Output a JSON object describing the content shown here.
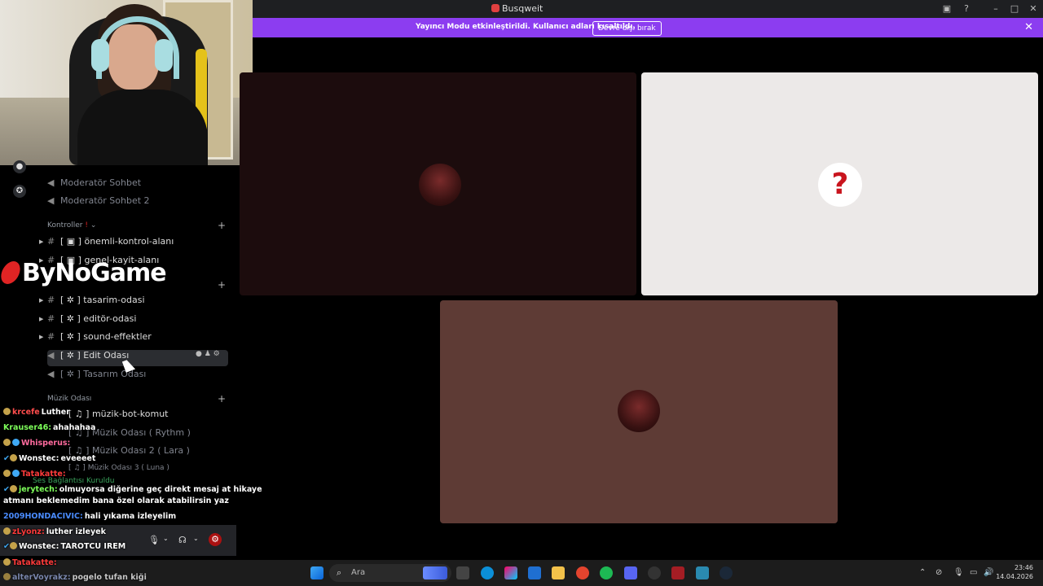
{
  "window": {
    "title": "Busqweit"
  },
  "banner": {
    "text": "Yayıncı Modu etkinleştirildi. Kullanıcı adları kısaltıldı.",
    "button": "Devre dışı bırak"
  },
  "sidebar": {
    "channels_top": [
      "Moderatör Sohbet",
      "Moderatör Sohbet 2"
    ],
    "category_controls": "Kontroller",
    "control_channels": [
      "önemli-kontrol-alanı",
      "genel-kayit-alanı"
    ],
    "design_channels": [
      "tasarim-odasi",
      "editör-odasi",
      "sound-effektler"
    ],
    "voice_design": [
      "Edit Odası",
      "Tasarım Odası"
    ],
    "category_music": "Müzik Odası",
    "music_channels": [
      "müzik-bot-komut",
      "Müzik Odası ( Rythm )",
      "Müzik Odası 2 ( Lara )",
      "Müzik Odası 3 ( Luna )"
    ],
    "voice_status": "Ses Bağlantısı Kuruldu"
  },
  "overlay": {
    "logo": "ByNoGame"
  },
  "chat": [
    {
      "user": "krcefe",
      "msg": "Luther"
    },
    {
      "user": "Krauser46:",
      "msg": "ahahahaa"
    },
    {
      "user": "Whisperus:",
      "msg": ""
    },
    {
      "user": "Wonstec:",
      "msg": "eveeeet"
    },
    {
      "user": "Tatakatte:",
      "msg": ""
    },
    {
      "user": "jerytech:",
      "msg": "olmuyorsa diğerine geç direkt mesaj at hikaye"
    },
    {
      "user": "",
      "msg": "atmanı beklemedim bana özel olarak atabilirsin yaz"
    },
    {
      "user": "2009HONDACIVIC:",
      "msg": "hali yıkama izleyelim"
    },
    {
      "user": "zLyonz:",
      "msg": "luther izleyek"
    },
    {
      "user": "Wonstec:",
      "msg": "TAROTCU IREM"
    },
    {
      "user": "Tatakatte:",
      "msg": ""
    },
    {
      "user": "alterVoyrakz:",
      "msg": "pogelo tufan kiği"
    }
  ],
  "taskbar": {
    "search_placeholder": "Ara",
    "time": "23:46",
    "date": "14.04.2026"
  },
  "colors": {
    "accent": "#8c3df0",
    "tile_dark": "#1c0c0d",
    "tile_light": "#ece9e8",
    "tile_brown": "#5e3b35"
  }
}
